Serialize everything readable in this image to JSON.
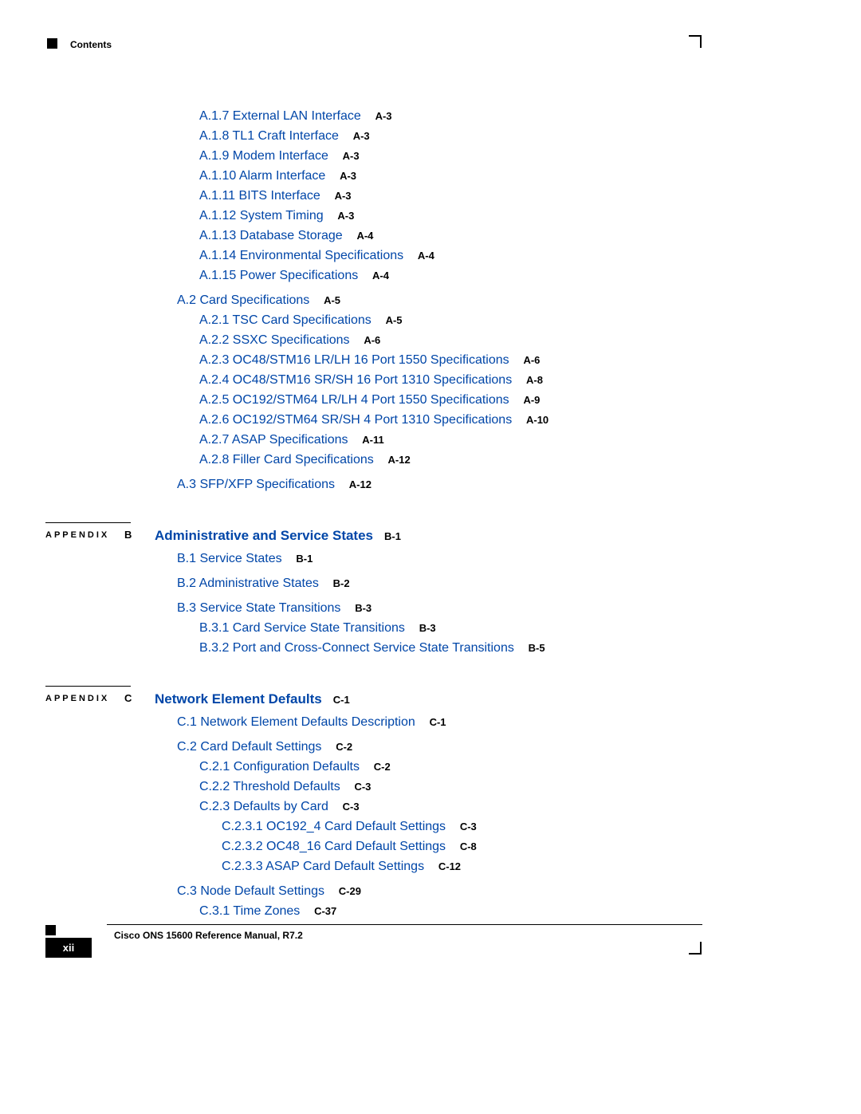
{
  "header": {
    "label": "Contents"
  },
  "appendixWord": "APPENDIX",
  "sections": {
    "a1": [
      {
        "t": "A.1.7  External LAN Interface",
        "p": "A-3"
      },
      {
        "t": "A.1.8  TL1 Craft Interface",
        "p": "A-3"
      },
      {
        "t": "A.1.9  Modem Interface",
        "p": "A-3"
      },
      {
        "t": "A.1.10  Alarm Interface",
        "p": "A-3"
      },
      {
        "t": "A.1.11  BITS Interface",
        "p": "A-3"
      },
      {
        "t": "A.1.12  System Timing",
        "p": "A-3"
      },
      {
        "t": "A.1.13  Database Storage",
        "p": "A-4"
      },
      {
        "t": "A.1.14  Environmental Specifications",
        "p": "A-4"
      },
      {
        "t": "A.1.15  Power Specifications",
        "p": "A-4"
      }
    ],
    "a2": {
      "t": "A.2  Card Specifications",
      "p": "A-5"
    },
    "a2s": [
      {
        "t": "A.2.1  TSC Card Specifications",
        "p": "A-5"
      },
      {
        "t": "A.2.2  SSXC Specifications",
        "p": "A-6"
      },
      {
        "t": "A.2.3  OC48/STM16 LR/LH 16 Port 1550 Specifications",
        "p": "A-6"
      },
      {
        "t": "A.2.4  OC48/STM16 SR/SH 16 Port 1310 Specifications",
        "p": "A-8"
      },
      {
        "t": "A.2.5  OC192/STM64 LR/LH 4 Port 1550 Specifications",
        "p": "A-9"
      },
      {
        "t": "A.2.6  OC192/STM64 SR/SH 4 Port 1310 Specifications",
        "p": "A-10"
      },
      {
        "t": "A.2.7  ASAP Specifications",
        "p": "A-11"
      },
      {
        "t": "A.2.8  Filler Card Specifications",
        "p": "A-12"
      }
    ],
    "a3": {
      "t": "A.3  SFP/XFP Specifications",
      "p": "A-12"
    }
  },
  "appB": {
    "letter": "B",
    "title": "Administrative and Service States",
    "page": "B-1",
    "l1": [
      {
        "t": "B.1  Service States",
        "p": "B-1"
      },
      {
        "t": "B.2  Administrative States",
        "p": "B-2"
      },
      {
        "t": "B.3  Service State Transitions",
        "p": "B-3"
      }
    ],
    "l2": [
      {
        "t": "B.3.1  Card Service State Transitions",
        "p": "B-3"
      },
      {
        "t": "B.3.2  Port and Cross-Connect Service State Transitions",
        "p": "B-5"
      }
    ]
  },
  "appC": {
    "letter": "C",
    "title": "Network Element Defaults",
    "page": "C-1",
    "c1": {
      "t": "C.1  Network Element Defaults Description",
      "p": "C-1"
    },
    "c2": {
      "t": "C.2  Card Default Settings",
      "p": "C-2"
    },
    "c2s": [
      {
        "t": "C.2.1  Configuration Defaults",
        "p": "C-2"
      },
      {
        "t": "C.2.2  Threshold Defaults",
        "p": "C-3"
      },
      {
        "t": "C.2.3  Defaults by Card",
        "p": "C-3"
      }
    ],
    "c23s": [
      {
        "t": "C.2.3.1  OC192_4 Card Default Settings",
        "p": "C-3"
      },
      {
        "t": "C.2.3.2  OC48_16 Card Default Settings",
        "p": "C-8"
      },
      {
        "t": "C.2.3.3  ASAP Card Default Settings",
        "p": "C-12"
      }
    ],
    "c3": {
      "t": "C.3  Node Default Settings",
      "p": "C-29"
    },
    "c31": {
      "t": "C.3.1  Time Zones",
      "p": "C-37"
    }
  },
  "footer": {
    "title": "Cisco ONS 15600 Reference Manual, R7.2",
    "page": "xii"
  }
}
